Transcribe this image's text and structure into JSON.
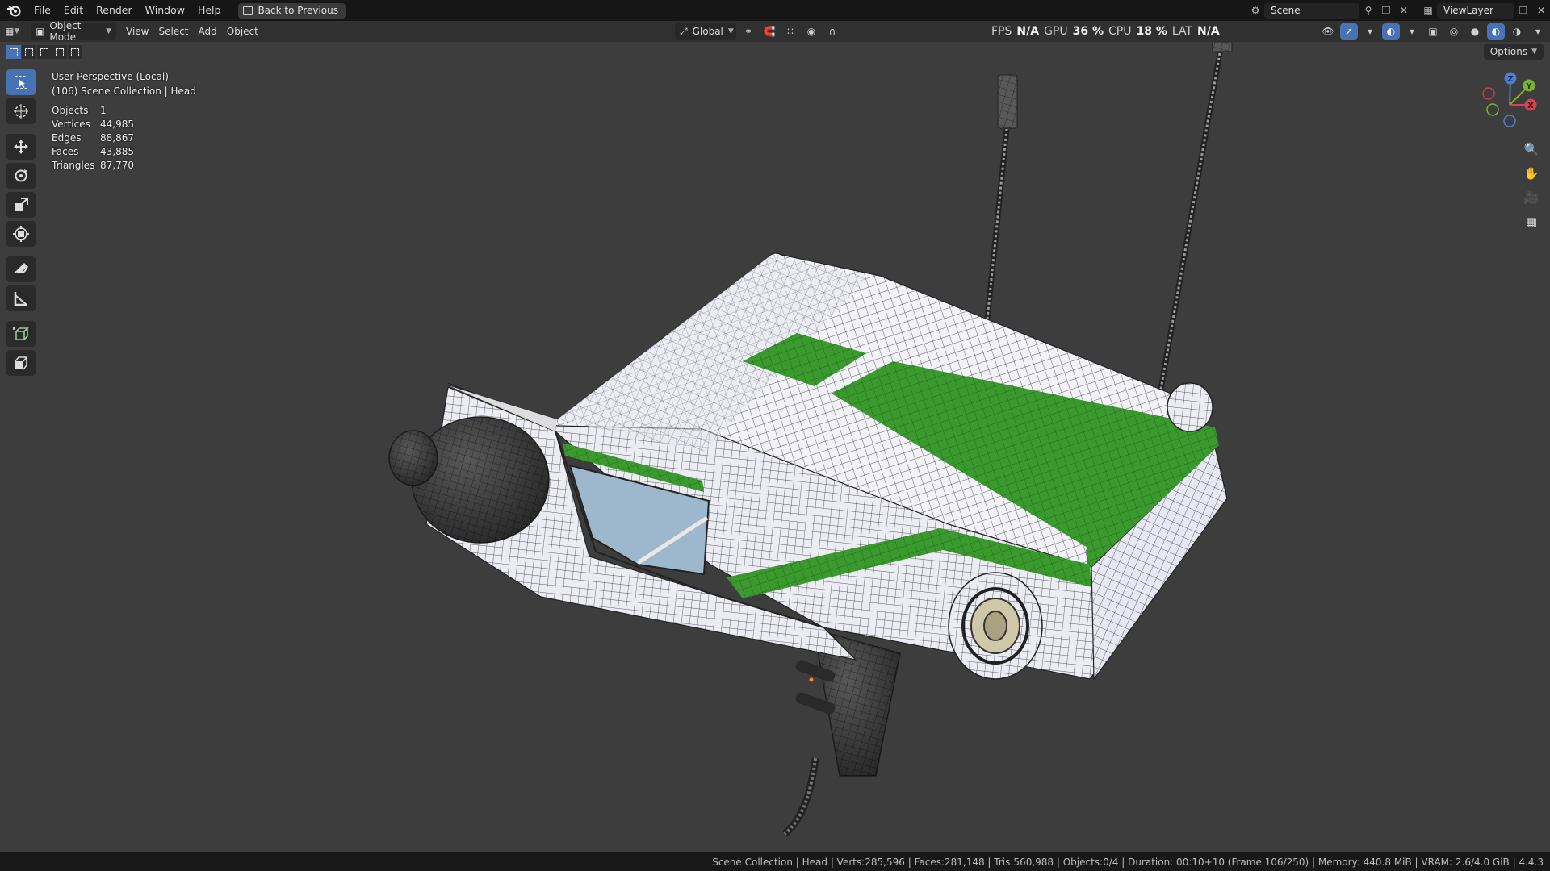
{
  "menubar": {
    "items": [
      "File",
      "Edit",
      "Render",
      "Window",
      "Help"
    ],
    "back_button": "Back to Previous",
    "scene_name": "Scene",
    "view_layer": "ViewLayer"
  },
  "viewport_header": {
    "mode": "Object Mode",
    "menus": [
      "View",
      "Select",
      "Add",
      "Object"
    ],
    "transform_orientation": "Global",
    "stats": {
      "fps_label": "FPS",
      "fps_value": "N/A",
      "gpu_label": "GPU",
      "gpu_value": "36 %",
      "cpu_label": "CPU",
      "cpu_value": "18 %",
      "lat_label": "LAT",
      "lat_value": "N/A"
    },
    "options_label": "Options"
  },
  "viewport": {
    "view_name": "User Perspective (Local)",
    "collection_line": "(106) Scene Collection | Head",
    "stats": [
      {
        "label": "Objects",
        "value": "1"
      },
      {
        "label": "Vertices",
        "value": "44,985"
      },
      {
        "label": "Edges",
        "value": "88,867"
      },
      {
        "label": "Faces",
        "value": "43,885"
      },
      {
        "label": "Triangles",
        "value": "87,770"
      }
    ],
    "gizmo_axes": {
      "x": "X",
      "y": "Y",
      "z": "Z"
    },
    "colors": {
      "background": "#3d3d3d",
      "mesh_white": "#f2f2f8",
      "mesh_green": "#3a9a2e",
      "window_blue": "#9db8cc",
      "wire": "#2a2a2a",
      "active_blue": "#4772b3"
    }
  },
  "statusbar": {
    "text": "Scene Collection | Head | Verts:285,596 | Faces:281,148 | Tris:560,988 | Objects:0/4 | Duration: 00:10+10 (Frame 106/250) | Memory: 440.8 MiB | VRAM: 2.6/4.0 GiB | 4.4.3"
  }
}
